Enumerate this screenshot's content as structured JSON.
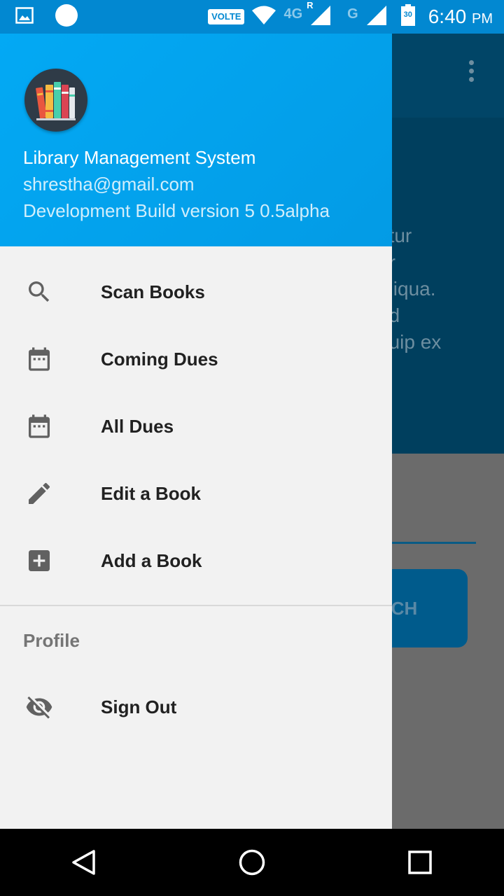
{
  "status_bar": {
    "volte": "VOLTE",
    "network_4g": "4G",
    "roaming": "R",
    "network_g": "G",
    "battery": "30",
    "time": "6:40",
    "ampm": "PM"
  },
  "background": {
    "text_lines": [
      "etur",
      "or",
      "aliqua.",
      "ud",
      "quip ex"
    ],
    "search_button": "RCH"
  },
  "drawer": {
    "header": {
      "title": "Library Management System",
      "email": "shrestha@gmail.com",
      "version": "Development Build version 5 0.5alpha"
    },
    "items": [
      {
        "label": "Scan Books",
        "icon": "search-icon"
      },
      {
        "label": "Coming Dues",
        "icon": "calendar-icon"
      },
      {
        "label": "All Dues",
        "icon": "calendar-icon"
      },
      {
        "label": "Edit a Book",
        "icon": "pencil-icon"
      },
      {
        "label": "Add a Book",
        "icon": "add-box-icon"
      }
    ],
    "section_label": "Profile",
    "profile_items": [
      {
        "label": "Sign Out",
        "icon": "eye-off-icon"
      }
    ]
  },
  "colors": {
    "status_bar": "#0288d1",
    "header": "#03a9f4",
    "drawer_bg": "#f2f2f2",
    "icon": "#616161"
  }
}
